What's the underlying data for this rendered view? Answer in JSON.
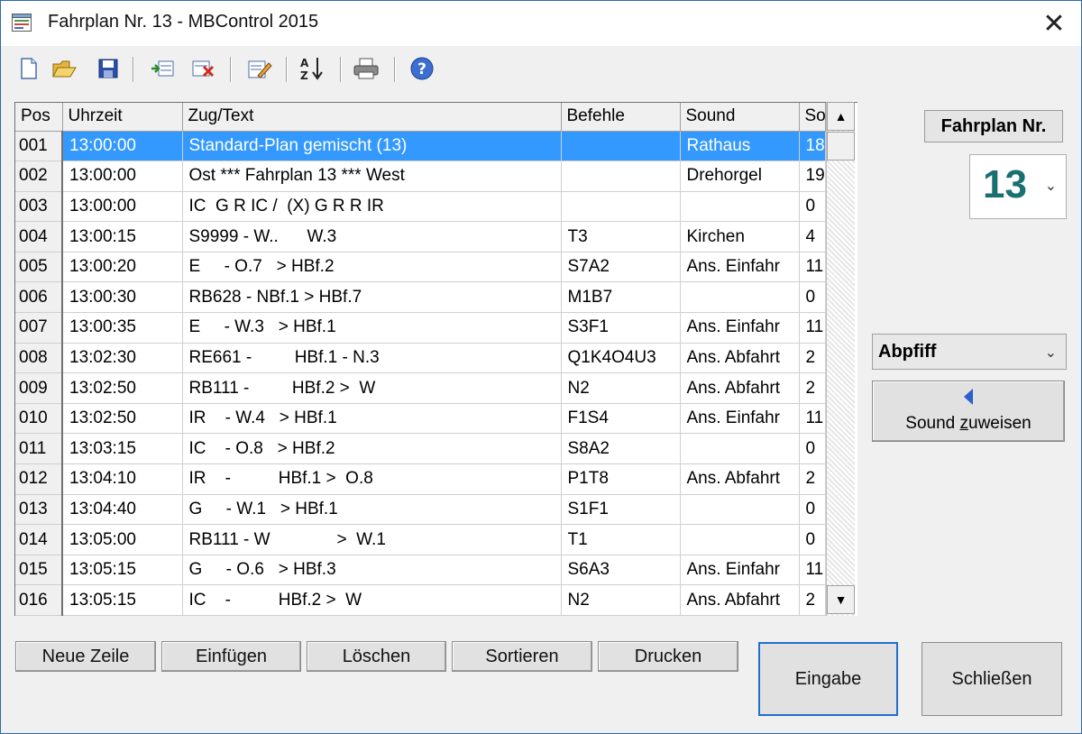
{
  "window": {
    "title": "Fahrplan Nr. 13 - MBControl 2015",
    "close_glyph": "✕"
  },
  "toolbar": {
    "buttons": [
      {
        "icon": "new-document-icon"
      },
      {
        "icon": "open-folder-icon"
      },
      {
        "icon": "save-disk-icon"
      },
      {
        "icon": "insert-row-icon"
      },
      {
        "icon": "delete-row-icon"
      },
      {
        "icon": "edit-icon"
      },
      {
        "icon": "sort-az-icon"
      },
      {
        "icon": "print-icon"
      },
      {
        "icon": "help-icon"
      }
    ]
  },
  "table": {
    "columns": [
      "Pos",
      "Uhrzeit",
      "Zug/Text",
      "Befehle",
      "Sound",
      "So"
    ],
    "selected_row": 0,
    "rows": [
      {
        "pos": "001",
        "time": "13:00:00",
        "text": "Standard-Plan gemischt (13)",
        "cmd": "",
        "sound": "Rathaus",
        "so": "18"
      },
      {
        "pos": "002",
        "time": "13:00:00",
        "text": "Ost *** Fahrplan 13 *** West",
        "cmd": "",
        "sound": "Drehorgel",
        "so": "19"
      },
      {
        "pos": "003",
        "time": "13:00:00",
        "text": "IC  G R IC /  (X) G R R IR",
        "cmd": "",
        "sound": "",
        "so": "0"
      },
      {
        "pos": "004",
        "time": "13:00:15",
        "text": "S9999 - W..      W.3",
        "cmd": "T3",
        "sound": "Kirchen",
        "so": "4"
      },
      {
        "pos": "005",
        "time": "13:00:20",
        "text": "E     - O.7   > HBf.2",
        "cmd": "S7A2",
        "sound": "Ans. Einfahr",
        "so": "11"
      },
      {
        "pos": "006",
        "time": "13:00:30",
        "text": "RB628 - NBf.1 > HBf.7",
        "cmd": "M1B7",
        "sound": "",
        "so": "0"
      },
      {
        "pos": "007",
        "time": "13:00:35",
        "text": "E     - W.3   > HBf.1",
        "cmd": "S3F1",
        "sound": "Ans. Einfahr",
        "so": "11"
      },
      {
        "pos": "008",
        "time": "13:02:30",
        "text": "RE661 -         HBf.1 - N.3",
        "cmd": "Q1K4O4U3",
        "sound": "Ans. Abfahrt",
        "so": "2"
      },
      {
        "pos": "009",
        "time": "13:02:50",
        "text": "RB111 -         HBf.2 >  W",
        "cmd": "N2",
        "sound": "Ans. Abfahrt",
        "so": "2"
      },
      {
        "pos": "010",
        "time": "13:02:50",
        "text": "IR    - W.4   > HBf.1",
        "cmd": "F1S4",
        "sound": "Ans. Einfahr",
        "so": "11"
      },
      {
        "pos": "011",
        "time": "13:03:15",
        "text": "IC    - O.8   > HBf.2",
        "cmd": "S8A2",
        "sound": "",
        "so": "0"
      },
      {
        "pos": "012",
        "time": "13:04:10",
        "text": "IR    -          HBf.1 >  O.8",
        "cmd": "P1T8",
        "sound": "Ans. Abfahrt",
        "so": "2"
      },
      {
        "pos": "013",
        "time": "13:04:40",
        "text": "G     - W.1   > HBf.1",
        "cmd": "S1F1",
        "sound": "",
        "so": "0"
      },
      {
        "pos": "014",
        "time": "13:05:00",
        "text": "RB111 - W              >  W.1",
        "cmd": "T1",
        "sound": "",
        "so": "0"
      },
      {
        "pos": "015",
        "time": "13:05:15",
        "text": "G     - O.6   > HBf.3",
        "cmd": "S6A3",
        "sound": "Ans. Einfahr",
        "so": "11"
      },
      {
        "pos": "016",
        "time": "13:05:15",
        "text": "IC    -          HBf.2 >  W",
        "cmd": "N2",
        "sound": "Ans. Abfahrt",
        "so": "2"
      }
    ]
  },
  "fahrplan": {
    "label": "Fahrplan Nr.",
    "value": "13"
  },
  "sound_panel": {
    "selected": "Abpfiff",
    "assign_prefix": "Sound ",
    "assign_mnemonic": "z",
    "assign_suffix": "uweisen"
  },
  "buttons": {
    "new_row": "Neue Zeile",
    "insert": "Einfügen",
    "delete": "Löschen",
    "sort": "Sortieren",
    "print": "Drucken",
    "enter": "Eingabe",
    "close": "Schließen"
  },
  "colors": {
    "selection": "#3399ff",
    "fahrplan_number": "#1a7070",
    "default_button_border": "#1f6fd0"
  }
}
